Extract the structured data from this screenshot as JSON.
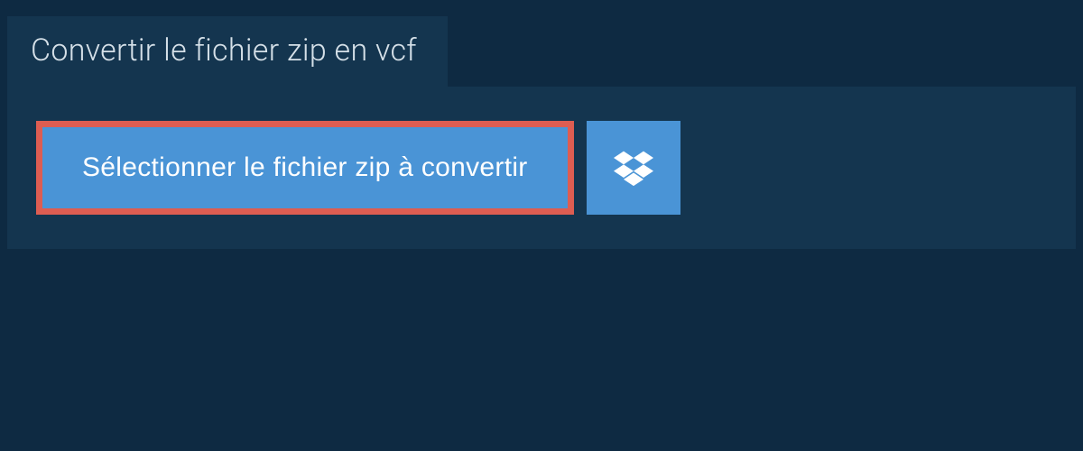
{
  "tab": {
    "title": "Convertir le fichier zip en vcf"
  },
  "selectButton": {
    "label": "Sélectionner le fichier zip à convertir"
  },
  "colors": {
    "background": "#0e2a42",
    "panel": "#14354f",
    "button": "#4a94d6",
    "highlight": "#dd5d52",
    "text": "#ffffff"
  },
  "icons": {
    "dropbox": "dropbox-icon"
  }
}
